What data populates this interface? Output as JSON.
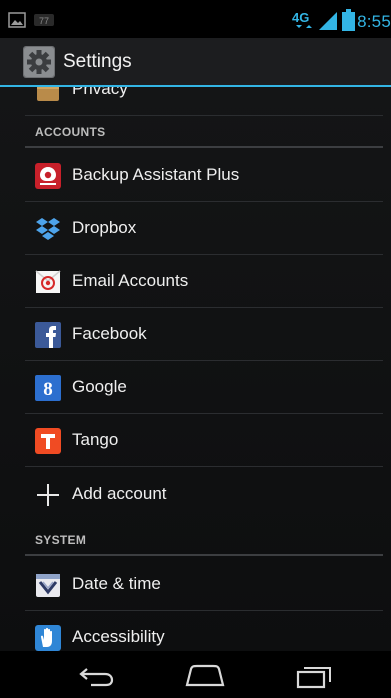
{
  "status_bar": {
    "time": "8:55",
    "network": "4G",
    "icons": [
      "image-notification-icon",
      "voicemail-icon",
      "lte-icon",
      "signal-icon",
      "battery-icon"
    ]
  },
  "action_bar": {
    "title": "Settings",
    "icon": "settings-gear-icon"
  },
  "list": {
    "partial_item": {
      "label": "Privacy",
      "icon": "privacy-icon"
    },
    "accounts_header": "ACCOUNTS",
    "accounts": [
      {
        "label": "Backup Assistant Plus",
        "icon": "backup-assistant-icon"
      },
      {
        "label": "Dropbox",
        "icon": "dropbox-icon"
      },
      {
        "label": "Email Accounts",
        "icon": "email-icon"
      },
      {
        "label": "Facebook",
        "icon": "facebook-icon"
      },
      {
        "label": "Google",
        "icon": "google-icon"
      },
      {
        "label": "Tango",
        "icon": "tango-icon"
      }
    ],
    "add_account": {
      "label": "Add account",
      "icon": "plus-icon"
    },
    "system_header": "SYSTEM",
    "system": [
      {
        "label": "Date & time",
        "icon": "calendar-clock-icon"
      },
      {
        "label": "Accessibility",
        "icon": "accessibility-hand-icon"
      }
    ]
  },
  "nav_bar": {
    "buttons": [
      "back-icon",
      "home-icon",
      "recent-apps-icon"
    ]
  },
  "colors": {
    "accent": "#33b5e5",
    "background": "#111213",
    "text": "#efefef",
    "header_text": "#bdbdbd"
  }
}
